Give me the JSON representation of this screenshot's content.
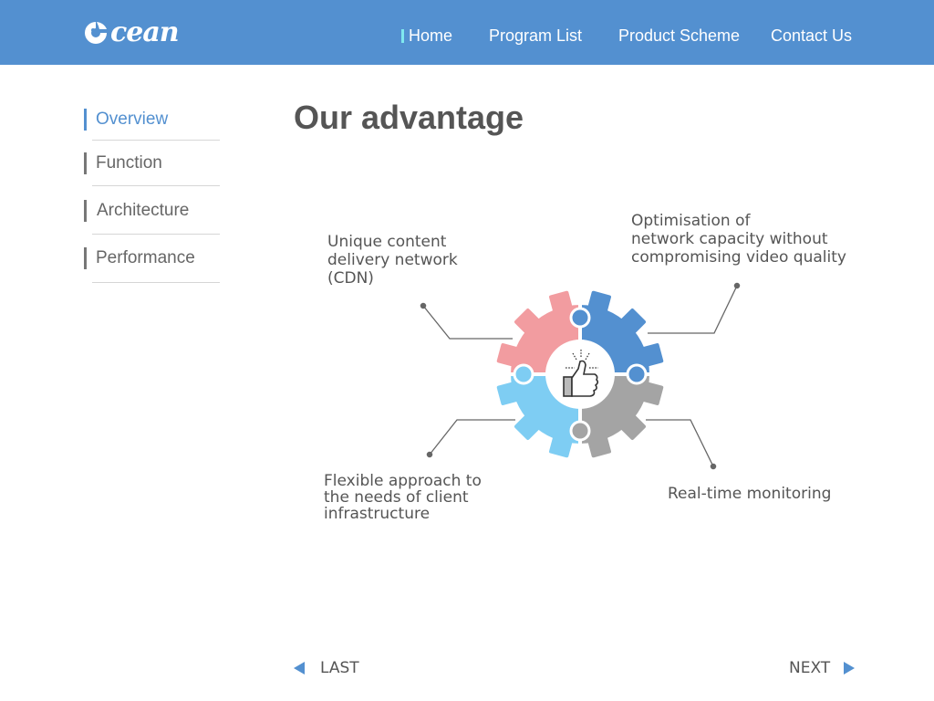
{
  "brand": {
    "logo_text": "cean",
    "logo_letter": "O"
  },
  "nav": {
    "items": [
      {
        "label": "Home",
        "active": true
      },
      {
        "label": "Program List"
      },
      {
        "label": "Product Scheme"
      },
      {
        "label": "Contact Us"
      }
    ]
  },
  "sidebar": {
    "items": [
      {
        "label": "Overview",
        "active": true
      },
      {
        "label": "Function"
      },
      {
        "label": "Architecture"
      },
      {
        "label": "Performance"
      }
    ]
  },
  "main": {
    "title": "Our advantage",
    "features": [
      {
        "text": "Unique content\ndelivery network\n(CDN)",
        "color": "#f29ca0"
      },
      {
        "text": "Optimisation of\nnetwork capacity without\ncompromising video quality",
        "color": "#5390d0"
      },
      {
        "text": "Flexible approach to\nthe needs of client\ninfrastructure",
        "color": "#7ecdf3"
      },
      {
        "text": "Real-time monitoring",
        "color": "#a4a4a4"
      }
    ],
    "center_icon": "thumbs-up-icon"
  },
  "pager": {
    "prev_label": "LAST",
    "next_label": "NEXT"
  },
  "colors": {
    "header": "#5390d0",
    "accent": "#5390d0",
    "nav_marker": "#7fe8f0"
  }
}
